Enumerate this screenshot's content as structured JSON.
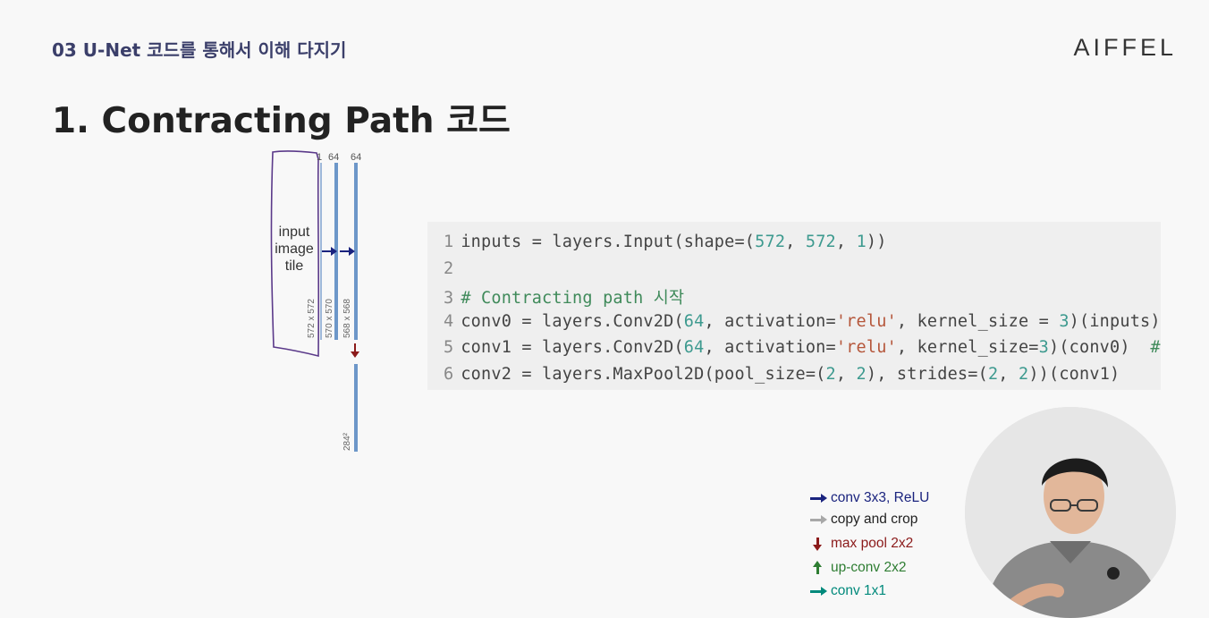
{
  "header": {
    "section_label": "03 U-Net 코드를 통해서 이해 다지기",
    "brand": "AIFFEL"
  },
  "slide_title": "1. Contracting Path 코드",
  "diagram": {
    "input_label_line1": "input",
    "input_label_line2": "image",
    "input_label_line3": "tile",
    "channels_1": "1",
    "channels_2": "64",
    "channels_3": "64",
    "dim_1": "572 x 572",
    "dim_2": "570 x 570",
    "dim_3": "568 x 568",
    "dim_4": "284²"
  },
  "code": {
    "lines": [
      {
        "n": "1",
        "segments": [
          [
            "t",
            "inputs = layers.Input(shape=("
          ],
          [
            "n",
            "572"
          ],
          [
            "t",
            ", "
          ],
          [
            "n",
            "572"
          ],
          [
            "t",
            ", "
          ],
          [
            "n",
            "1"
          ],
          [
            "t",
            "))"
          ]
        ]
      },
      {
        "n": "2",
        "segments": []
      },
      {
        "n": "3",
        "segments": [
          [
            "c",
            "# Contracting path 시작"
          ]
        ]
      },
      {
        "n": "4",
        "segments": [
          [
            "t",
            "conv0 = layers.Conv2D("
          ],
          [
            "n",
            "64"
          ],
          [
            "t",
            ", activation="
          ],
          [
            "s",
            "'relu'"
          ],
          [
            "t",
            ", kernel_size = "
          ],
          [
            "n",
            "3"
          ],
          [
            "t",
            ")(inputs)"
          ]
        ]
      },
      {
        "n": "5",
        "segments": [
          [
            "t",
            "conv1 = layers.Conv2D("
          ],
          [
            "n",
            "64"
          ],
          [
            "t",
            ", activation="
          ],
          [
            "s",
            "'relu'"
          ],
          [
            "t",
            ", kernel_size="
          ],
          [
            "n",
            "3"
          ],
          [
            "t",
            ")(conv0)  "
          ],
          [
            "c",
            "#"
          ]
        ]
      },
      {
        "n": "6",
        "segments": [
          [
            "t",
            "conv2 = layers.MaxPool2D(pool_size=("
          ],
          [
            "n",
            "2"
          ],
          [
            "t",
            ", "
          ],
          [
            "n",
            "2"
          ],
          [
            "t",
            "), strides=("
          ],
          [
            "n",
            "2"
          ],
          [
            "t",
            ", "
          ],
          [
            "n",
            "2"
          ],
          [
            "t",
            "))(conv1)"
          ]
        ]
      }
    ]
  },
  "legend": {
    "items": [
      {
        "label": "conv 3x3, ReLU",
        "color": "#1a237e",
        "icon": "arrow-right-icon"
      },
      {
        "label": "copy and crop",
        "color": "#a8a8a8",
        "icon": "arrow-right-icon"
      },
      {
        "label": "max pool 2x2",
        "color": "#8b1a1a",
        "icon": "arrow-down-icon"
      },
      {
        "label": "up-conv 2x2",
        "color": "#2e7d32",
        "icon": "arrow-up-icon"
      },
      {
        "label": "conv 1x1",
        "color": "#00897b",
        "icon": "arrow-right-icon"
      }
    ]
  }
}
